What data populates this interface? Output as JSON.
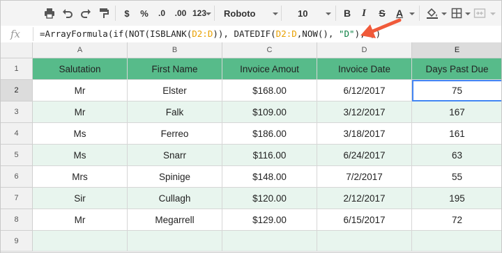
{
  "toolbar": {
    "format_currency": "$",
    "format_percent": "%",
    "decrease_decimals": ".0",
    "increase_decimals": ".00",
    "more_formats": "123",
    "font_name": "Roboto",
    "font_size": "10",
    "bold": "B",
    "italic": "I",
    "strikethrough": "S",
    "text_color": "A"
  },
  "formula_bar": {
    "fx_label": "fx",
    "parts": [
      {
        "text": "=ArrayFormula(if(NOT(ISBLANK(",
        "kind": "plain"
      },
      {
        "text": "D2:D",
        "kind": "range"
      },
      {
        "text": ")), DATEDIF(",
        "kind": "plain"
      },
      {
        "text": "D2:D",
        "kind": "range"
      },
      {
        "text": ",NOW(), ",
        "kind": "plain"
      },
      {
        "text": "\"D\"",
        "kind": "string"
      },
      {
        "text": "), ))",
        "kind": "plain"
      }
    ]
  },
  "colors": {
    "header_fill": "#57bb8a",
    "band_fill": "#e8f5ee",
    "arrow": "#f05a3a",
    "selection": "#4285f4",
    "range_ref": "#e8a000",
    "string_literal": "#0b8043"
  },
  "grid": {
    "column_letters": [
      "A",
      "B",
      "C",
      "D",
      "E"
    ],
    "row_numbers": [
      "1",
      "2",
      "3",
      "4",
      "5",
      "6",
      "7",
      "8",
      "9"
    ],
    "active_cell": "E2",
    "headers": [
      "Salutation",
      "First Name",
      "Invoice Amout",
      "Invoice Date",
      "Days Past Due"
    ],
    "rows": [
      [
        "Mr",
        "Elster",
        "$168.00",
        "6/12/2017",
        "75"
      ],
      [
        "Mr",
        "Falk",
        "$109.00",
        "3/12/2017",
        "167"
      ],
      [
        "Ms",
        "Ferreo",
        "$186.00",
        "3/18/2017",
        "161"
      ],
      [
        "Ms",
        "Snarr",
        "$116.00",
        "6/24/2017",
        "63"
      ],
      [
        "Mrs",
        "Spinige",
        "$148.00",
        "7/2/2017",
        "55"
      ],
      [
        "Sir",
        "Cullagh",
        "$120.00",
        "2/12/2017",
        "195"
      ],
      [
        "Mr",
        "Megarrell",
        "$129.00",
        "6/15/2017",
        "72"
      ],
      [
        "",
        "",
        "",
        "",
        ""
      ]
    ]
  }
}
